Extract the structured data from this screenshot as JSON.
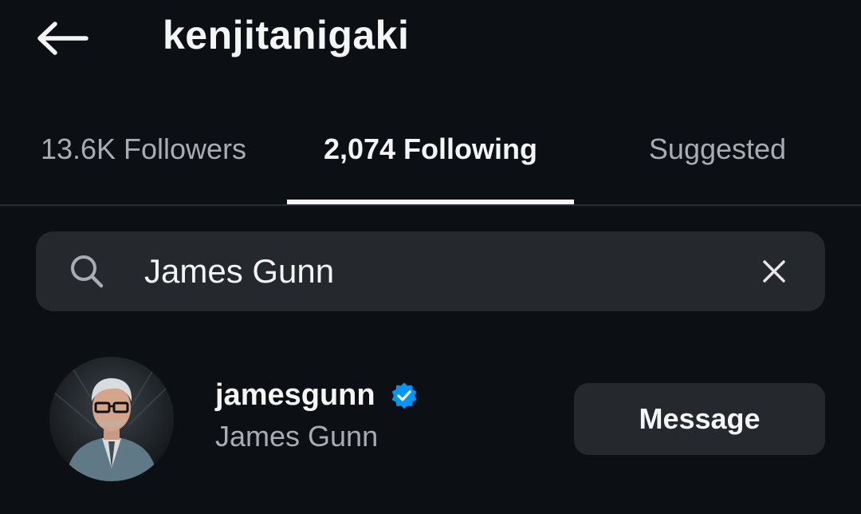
{
  "header": {
    "title": "kenjitanigaki",
    "back_icon": "arrow-left-icon"
  },
  "tabs": [
    {
      "label": "13.6K Followers",
      "active": false
    },
    {
      "label": "2,074 Following",
      "active": true
    },
    {
      "label": "Suggested",
      "active": false
    }
  ],
  "search": {
    "value": "James Gunn",
    "placeholder": "Search",
    "search_icon": "search-icon",
    "clear_icon": "close-icon"
  },
  "results": [
    {
      "username": "jamesgunn",
      "full_name": "James Gunn",
      "verified": true,
      "verified_icon": "verified-badge-icon",
      "action_label": "Message"
    }
  ],
  "colors": {
    "background": "#0c1014",
    "surface": "#25292e",
    "text_primary": "#f5f5f5",
    "text_secondary": "#a8adb3",
    "verified_blue": "#0095f6",
    "divider": "#2a2e33"
  }
}
